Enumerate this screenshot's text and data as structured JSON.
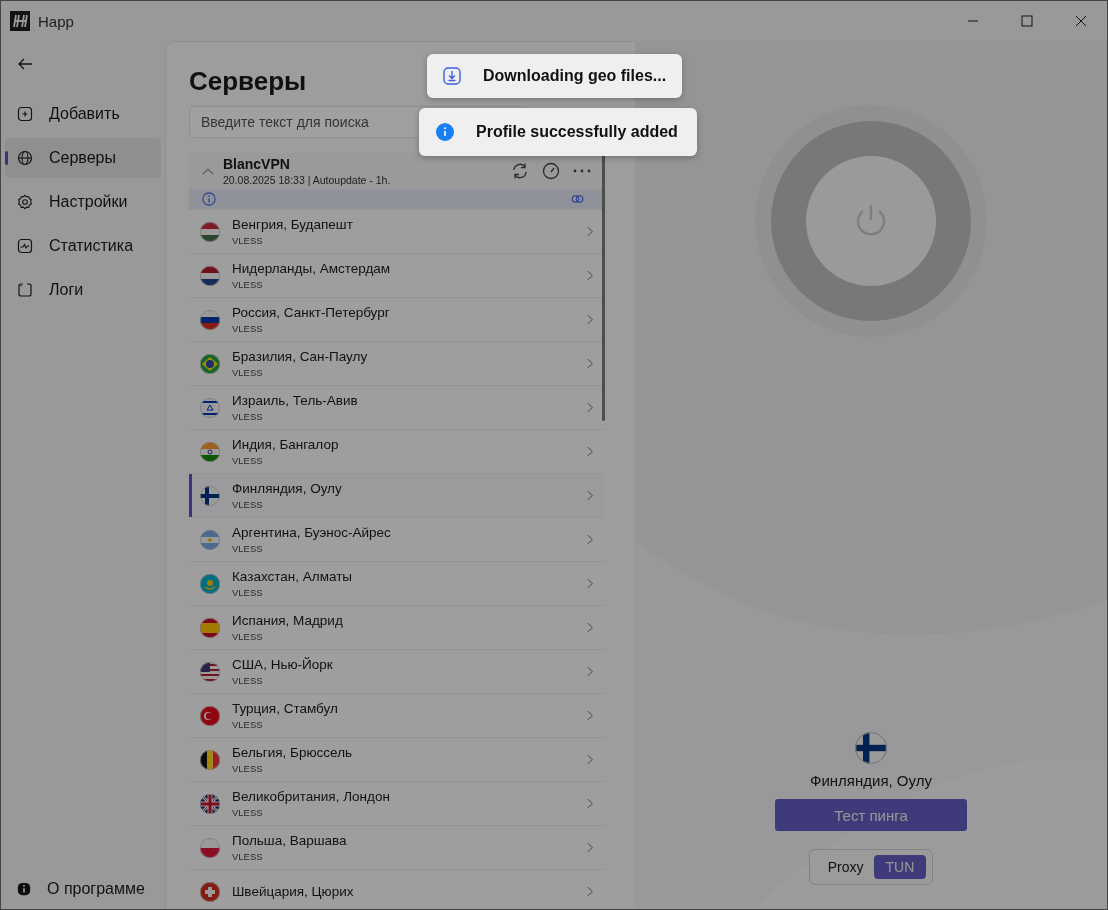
{
  "window": {
    "title": "Happ"
  },
  "dimmed": true,
  "sidebar": {
    "items": [
      {
        "label": "Добавить",
        "kind": "add",
        "selected": false
      },
      {
        "label": "Серверы",
        "kind": "globe",
        "selected": true
      },
      {
        "label": "Настройки",
        "kind": "gear",
        "selected": false
      },
      {
        "label": "Статистика",
        "kind": "chart",
        "selected": false
      },
      {
        "label": "Логи",
        "kind": "logs",
        "selected": false
      }
    ],
    "footer": "О программе"
  },
  "servers": {
    "title": "Серверы",
    "search": {
      "placeholder": "Введите текст для поиска"
    },
    "profile": {
      "name": "BlancVPN",
      "meta": "20.08.2025 18:33 | Autoupdate - 1h.",
      "expanded": true
    },
    "rows": [
      {
        "name": "Венгрия, Будапешт",
        "protocol": "VLESS",
        "kind": "hu",
        "selected": false
      },
      {
        "name": "Нидерланды, Амстердам",
        "protocol": "VLESS",
        "kind": "nl",
        "selected": false
      },
      {
        "name": "Россия, Санкт-Петербург",
        "protocol": "VLESS",
        "kind": "ru",
        "selected": false
      },
      {
        "name": "Бразилия, Сан-Паулу",
        "protocol": "VLESS",
        "kind": "br",
        "selected": false
      },
      {
        "name": "Израиль, Тель-Авив",
        "protocol": "VLESS",
        "kind": "il",
        "selected": false
      },
      {
        "name": "Индия, Бангалор",
        "protocol": "VLESS",
        "kind": "in",
        "selected": false
      },
      {
        "name": "Финляндия, Оулу",
        "protocol": "VLESS",
        "kind": "fi",
        "selected": true
      },
      {
        "name": "Аргентина, Буэнос-Айрес",
        "protocol": "VLESS",
        "kind": "ar",
        "selected": false
      },
      {
        "name": "Казахстан, Алматы",
        "protocol": "VLESS",
        "kind": "kz",
        "selected": false
      },
      {
        "name": "Испания, Мадрид",
        "protocol": "VLESS",
        "kind": "es",
        "selected": false
      },
      {
        "name": "США, Нью-Йорк",
        "protocol": "VLESS",
        "kind": "us",
        "selected": false
      },
      {
        "name": "Турция, Стамбул",
        "protocol": "VLESS",
        "kind": "tr",
        "selected": false
      },
      {
        "name": "Бельгия, Брюссель",
        "protocol": "VLESS",
        "kind": "be",
        "selected": false
      },
      {
        "name": "Великобритания, Лондон",
        "protocol": "VLESS",
        "kind": "gb",
        "selected": false
      },
      {
        "name": "Польша, Варшава",
        "protocol": "VLESS",
        "kind": "pl",
        "selected": false
      },
      {
        "name": "Швейцария, Цюрих",
        "kind": "ch",
        "selected": false
      }
    ]
  },
  "connection": {
    "location": "Финляндия, Оулу",
    "kind": "fi",
    "ping_button": "Тест пинга",
    "modes": [
      {
        "label": "Proxy",
        "selected": false
      },
      {
        "label": "TUN",
        "selected": true
      }
    ]
  },
  "toasts": [
    {
      "kind": "download",
      "text": "Downloading geo files..."
    },
    {
      "kind": "info",
      "text": "Profile successfully added"
    }
  ]
}
